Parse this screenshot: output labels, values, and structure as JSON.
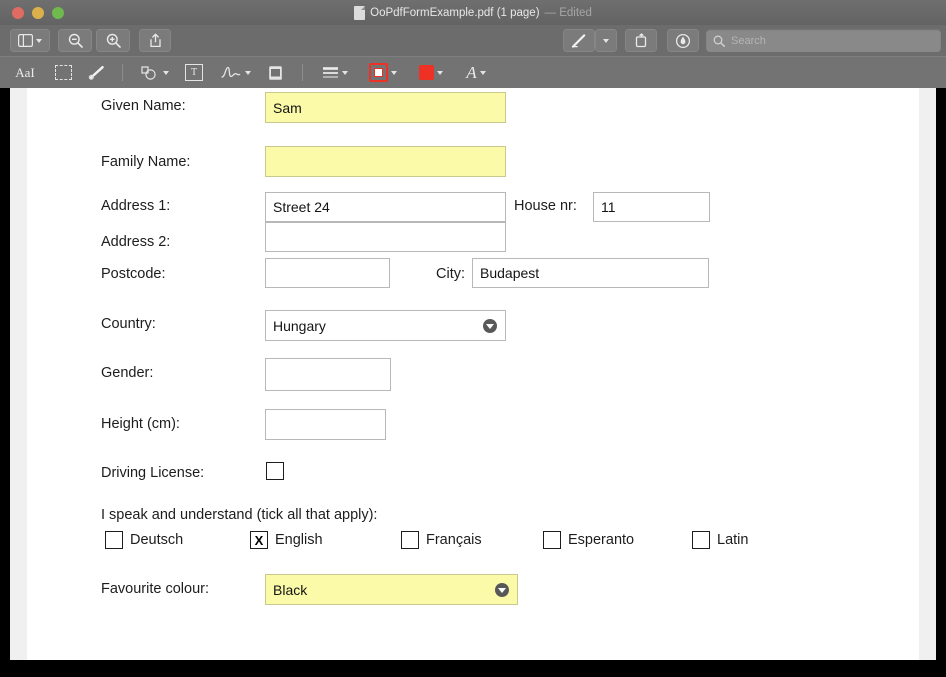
{
  "window": {
    "title_text": "OoPdfFormExample.pdf (1 page)",
    "title_edited": "— Edited",
    "traffic": {
      "close": "close-button",
      "minimize": "minimize-button",
      "maximize": "maximize-button"
    }
  },
  "toolbar_top": {
    "sidebar_label": "sidebar-toggle",
    "zoom_out_label": "zoom-out",
    "zoom_in_label": "zoom-in",
    "share_label": "share",
    "markup_label": "markup",
    "rotate_label": "rotate",
    "annotate_label": "annotate",
    "search_placeholder": "Search"
  },
  "toolbar_markup": {
    "text_select_label": "AaI",
    "rect_select_label": "rectangular-selection",
    "highlight_label": "highlight",
    "shapes_label": "shapes",
    "textbox_label": "T",
    "signature_label": "signature",
    "note_label": "note",
    "style_label": "shape-style",
    "border_color_label": "border-color",
    "fill_color_label": "fill-color",
    "font_label": "A",
    "accent_red": "#ee3124"
  },
  "form": {
    "rows": [
      {
        "label": "Given Name:",
        "value": "Sam"
      },
      {
        "label": "Family Name:",
        "value": ""
      },
      {
        "label": "Address 1:",
        "value": "Street 24"
      },
      {
        "label": "House nr:",
        "value": "11"
      },
      {
        "label": "Address 2:",
        "value": ""
      },
      {
        "label": "Postcode:",
        "value": ""
      },
      {
        "label": "City:",
        "value": "Budapest"
      },
      {
        "label": "Country:",
        "value": "Hungary"
      },
      {
        "label": "Gender:",
        "value": ""
      },
      {
        "label": "Height (cm):",
        "value": ""
      },
      {
        "label": "Driving License:",
        "value": ""
      }
    ],
    "languages_prompt": "I speak and understand (tick all that apply):",
    "languages": [
      {
        "label": "Deutsch",
        "checked": ""
      },
      {
        "label": "English",
        "checked": "X"
      },
      {
        "label": "Français",
        "checked": ""
      },
      {
        "label": "Esperanto",
        "checked": ""
      },
      {
        "label": "Latin",
        "checked": ""
      }
    ],
    "favourite_colour": {
      "label": "Favourite colour:",
      "value": "Black"
    },
    "highlight_colour": "#fafaa8"
  }
}
